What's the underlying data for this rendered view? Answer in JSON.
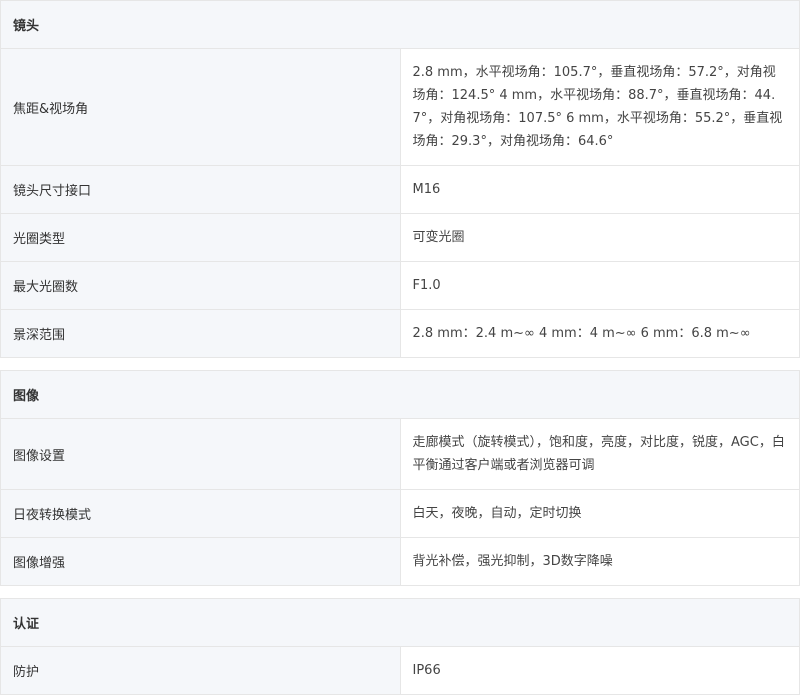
{
  "sections": [
    {
      "title": "镜头",
      "rows": [
        {
          "label": "焦距&视场角",
          "value": "2.8 mm，水平视场角：105.7°，垂直视场角：57.2°，对角视场角：124.5° 4 mm，水平视场角：88.7°，垂直视场角：44.7°，对角视场角：107.5° 6 mm，水平视场角：55.2°，垂直视场角：29.3°，对角视场角：64.6°"
        },
        {
          "label": "镜头尺寸接口",
          "value": "M16"
        },
        {
          "label": "光圈类型",
          "value": "可变光圈"
        },
        {
          "label": "最大光圈数",
          "value": "F1.0"
        },
        {
          "label": "景深范围",
          "value": "2.8 mm：2.4 m~∞ 4 mm：4 m~∞ 6 mm：6.8 m~∞"
        }
      ]
    },
    {
      "title": "图像",
      "rows": [
        {
          "label": "图像设置",
          "value": "走廊模式（旋转模式），饱和度，亮度，对比度，锐度，AGC，白平衡通过客户端或者浏览器可调"
        },
        {
          "label": "日夜转换模式",
          "value": "白天，夜晚，自动，定时切换"
        },
        {
          "label": "图像增强",
          "value": "背光补偿，强光抑制，3D数字降噪"
        }
      ]
    },
    {
      "title": "认证",
      "rows": [
        {
          "label": "防护",
          "value": "IP66"
        }
      ]
    }
  ]
}
